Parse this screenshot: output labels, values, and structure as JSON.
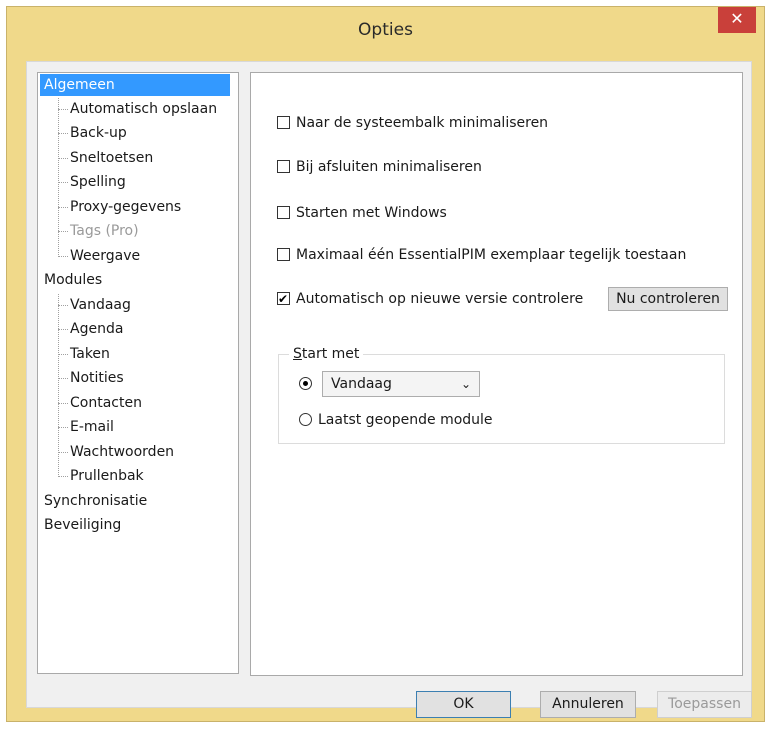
{
  "window": {
    "title": "Opties",
    "close_glyph": "✕"
  },
  "tree": {
    "items": [
      {
        "label": "Algemeen",
        "level": 0,
        "selected": true
      },
      {
        "label": "Automatisch opslaan",
        "level": 1
      },
      {
        "label": "Back-up",
        "level": 1
      },
      {
        "label": "Sneltoetsen",
        "level": 1
      },
      {
        "label": "Spelling",
        "level": 1
      },
      {
        "label": "Proxy-gegevens",
        "level": 1
      },
      {
        "label": "Tags (Pro)",
        "level": 1,
        "disabled": true
      },
      {
        "label": "Weergave",
        "level": 1
      },
      {
        "label": "Modules",
        "level": 0
      },
      {
        "label": "Vandaag",
        "level": 1
      },
      {
        "label": "Agenda",
        "level": 1
      },
      {
        "label": "Taken",
        "level": 1
      },
      {
        "label": "Notities",
        "level": 1
      },
      {
        "label": "Contacten",
        "level": 1
      },
      {
        "label": "E-mail",
        "level": 1
      },
      {
        "label": "Wachtwoorden",
        "level": 1
      },
      {
        "label": "Prullenbak",
        "level": 1
      },
      {
        "label": "Synchronisatie",
        "level": 0
      },
      {
        "label": "Beveiliging",
        "level": 0
      }
    ]
  },
  "options": {
    "checkboxes": [
      {
        "label": "Naar de systeembalk minimaliseren",
        "checked": false
      },
      {
        "label": "Bij afsluiten minimaliseren",
        "checked": false
      },
      {
        "label": "Starten met Windows",
        "checked": false
      },
      {
        "label": "Maximaal één EssentialPIM exemplaar tegelijk toestaan",
        "checked": false
      },
      {
        "label": "Automatisch op nieuwe versie controlere",
        "checked": true
      }
    ],
    "check_now_button": "Nu controleren",
    "start_group": {
      "legend_accel": "S",
      "legend_rest": "tart met",
      "radio_module_selected": true,
      "module_select_value": "Vandaag",
      "radio_last_label": "Laatst geopende module",
      "radio_last_selected": false
    }
  },
  "footer": {
    "ok_label": "OK",
    "cancel_label": "Annuleren",
    "apply_label": "Toepassen"
  },
  "colors": {
    "frame": "#f0d98a",
    "close_button": "#c9403a",
    "selection": "#3399ff"
  }
}
